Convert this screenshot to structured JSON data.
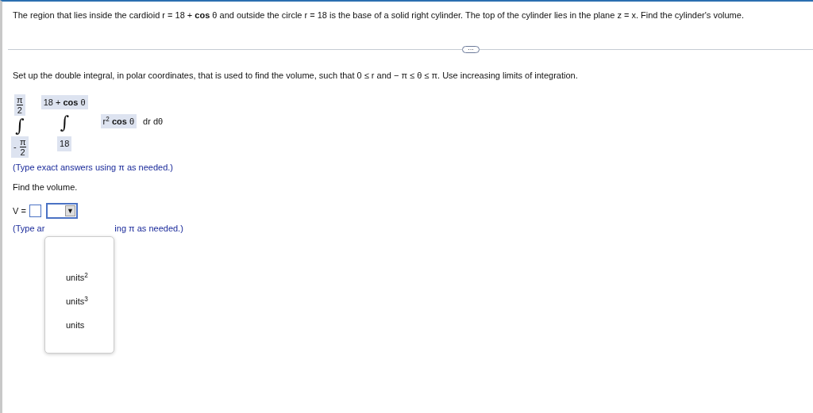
{
  "question": "The region that lies inside the cardioid r = 18 + **cos** θ and outside the circle r = 18 is the base of a solid right cylinder. The top of the cylinder lies in the plane z = x. Find the cylinder's volume.",
  "expand_button": "···",
  "setup_prompt": "Set up the double integral, in polar coordinates, that is used to find the volume, such that 0 ≤ r and  − π ≤ θ ≤ π. Use increasing limits of integration.",
  "integral": {
    "symbol": "∫",
    "outer_upper": {
      "numerator": "π",
      "denominator": "2"
    },
    "outer_lower": {
      "prefix": "-",
      "numerator": "π",
      "denominator": "2"
    },
    "inner_upper": "18 + **cos** θ",
    "inner_lower": "18",
    "integrand": "r$^{2}$ **cos** θ",
    "differentials": "dr dθ"
  },
  "hint_1": "(Type exact answers using π as needed.)",
  "find_prompt": "Find the volume.",
  "answer_label": "V =",
  "dropdown_arrow": "▼",
  "hint_2_parts": [
    "(Type ar",
    "ing π as needed.)"
  ],
  "unit_options": [
    {
      "label": "units$^{2}$",
      "selected": false
    },
    {
      "label": "units$^{3}$",
      "selected": false
    },
    {
      "label": "units",
      "selected": false
    }
  ]
}
